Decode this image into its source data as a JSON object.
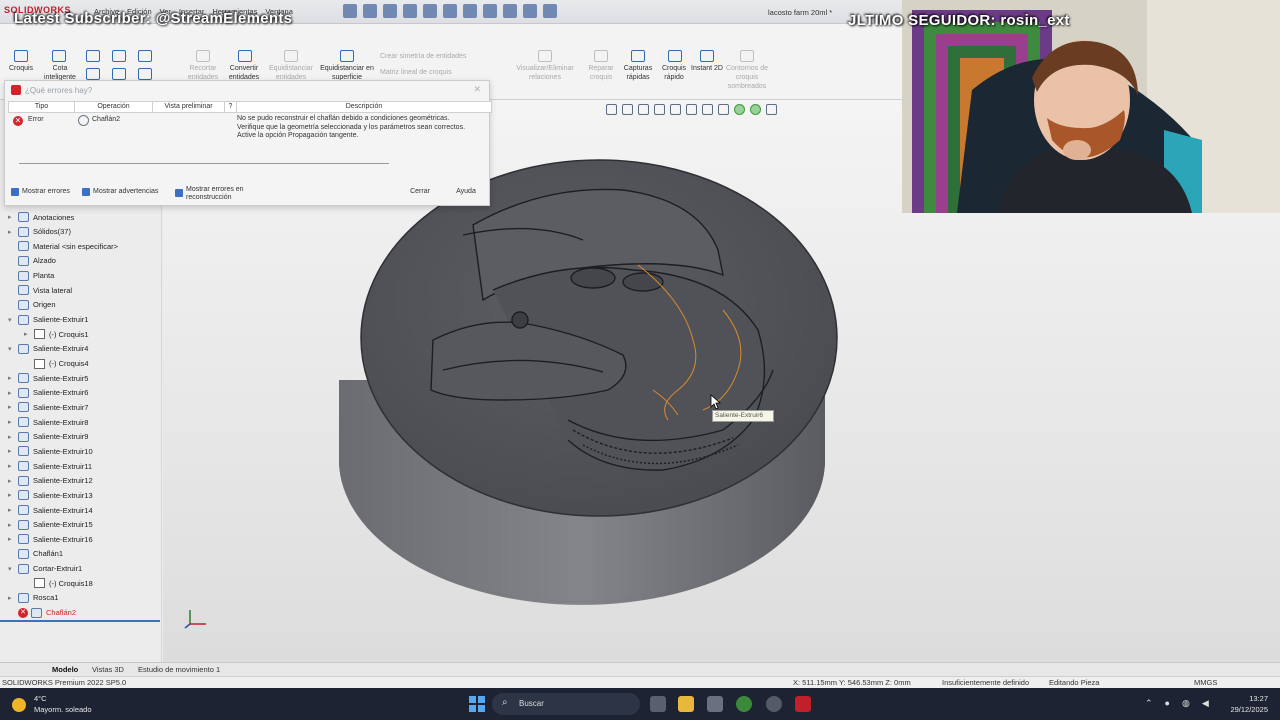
{
  "window": {
    "app_name": "SOLIDWORKS",
    "document_title": "lacosto farm 20ml *",
    "menu": [
      "Archivo",
      "Edición",
      "Ver",
      "Insertar",
      "Herramientas",
      "Ventana"
    ]
  },
  "overlays": {
    "latest_subscriber": "Latest Subscriber: @StreamElements",
    "last_follower": "JLTIMO SEGUIDOR: rosin_ext"
  },
  "ribbon": {
    "buttons": [
      {
        "label": "Croquis",
        "enabled": true
      },
      {
        "label": "Cota inteligente",
        "enabled": true
      },
      {
        "label": "Recortar entidades",
        "enabled": false
      },
      {
        "label": "Convertir entidades",
        "enabled": true
      },
      {
        "label": "Equidistanciar entidades",
        "enabled": false
      },
      {
        "label": "Equidistanciar en superficie",
        "enabled": true
      },
      {
        "label": "Crear simetría de entidades",
        "enabled": false
      },
      {
        "label": "Matriz lineal de croquis",
        "enabled": false
      },
      {
        "label": "Visualizar/Eliminar relaciones",
        "enabled": false
      },
      {
        "label": "Reparar croquis",
        "enabled": false
      },
      {
        "label": "Capturas rápidas",
        "enabled": true
      },
      {
        "label": "Croquis rápido",
        "enabled": true
      },
      {
        "label": "Instant 2D",
        "enabled": true
      },
      {
        "label": "Contornos de croquis sombreados",
        "enabled": false
      }
    ]
  },
  "error_dialog": {
    "title": "¿Qué errores hay?",
    "columns": [
      "Tipo",
      "Operación",
      "Vista preliminar",
      "?",
      "Descripción"
    ],
    "row": {
      "type": "Error",
      "operation": "Chaflán2",
      "description_lines": [
        "No se pudo reconstruir el chaflán debido a condiciones geométricas.",
        "Verifique que la geometría seleccionada y los parámetros sean correctos.",
        "Active la opción Propagación tangente."
      ]
    },
    "checkboxes": [
      {
        "label": "Mostrar errores",
        "checked": true
      },
      {
        "label": "Mostrar advertencias",
        "checked": true
      },
      {
        "label": "Mostrar errores en reconstrucción",
        "checked": true
      }
    ],
    "close_label": "Cerrar",
    "help_label": "Ayuda"
  },
  "feature_tree": [
    {
      "label": "Anotaciones",
      "expander": "▸",
      "level": 0,
      "icon": "annotations-icon"
    },
    {
      "label": "Sólidos(37)",
      "expander": "▸",
      "level": 0,
      "icon": "solid-bodies-icon"
    },
    {
      "label": "Material <sin especificar>",
      "expander": "",
      "level": 0,
      "icon": "material-icon"
    },
    {
      "label": "Alzado",
      "expander": "",
      "level": 0,
      "icon": "plane-icon"
    },
    {
      "label": "Planta",
      "expander": "",
      "level": 0,
      "icon": "plane-icon"
    },
    {
      "label": "Vista lateral",
      "expander": "",
      "level": 0,
      "icon": "plane-icon"
    },
    {
      "label": "Origen",
      "expander": "",
      "level": 0,
      "icon": "origin-icon"
    },
    {
      "label": "Saliente-Extruir1",
      "expander": "▾",
      "level": 0,
      "icon": "extrude-icon"
    },
    {
      "label": "(-) Croquis1",
      "expander": "▸",
      "level": 1,
      "icon": "sketch-icon"
    },
    {
      "label": "Saliente-Extruir4",
      "expander": "▾",
      "level": 0,
      "icon": "extrude-icon"
    },
    {
      "label": "(-) Croquis4",
      "expander": "",
      "level": 1,
      "icon": "sketch-icon"
    },
    {
      "label": "Saliente-Extruir5",
      "expander": "▸",
      "level": 0,
      "icon": "extrude-icon"
    },
    {
      "label": "Saliente-Extruir6",
      "expander": "▸",
      "level": 0,
      "icon": "extrude-icon"
    },
    {
      "label": "Saliente-Extruir7",
      "expander": "▸",
      "level": 0,
      "icon": "extrude-icon"
    },
    {
      "label": "Saliente-Extruir8",
      "expander": "▸",
      "level": 0,
      "icon": "extrude-icon"
    },
    {
      "label": "Saliente-Extruir9",
      "expander": "▸",
      "level": 0,
      "icon": "extrude-icon"
    },
    {
      "label": "Saliente-Extruir10",
      "expander": "▸",
      "level": 0,
      "icon": "extrude-icon"
    },
    {
      "label": "Saliente-Extruir11",
      "expander": "▸",
      "level": 0,
      "icon": "extrude-icon"
    },
    {
      "label": "Saliente-Extruir12",
      "expander": "▸",
      "level": 0,
      "icon": "extrude-icon"
    },
    {
      "label": "Saliente-Extruir13",
      "expander": "▸",
      "level": 0,
      "icon": "extrude-icon"
    },
    {
      "label": "Saliente-Extruir14",
      "expander": "▸",
      "level": 0,
      "icon": "extrude-icon"
    },
    {
      "label": "Saliente-Extruir15",
      "expander": "▸",
      "level": 0,
      "icon": "extrude-icon"
    },
    {
      "label": "Saliente-Extruir16",
      "expander": "▸",
      "level": 0,
      "icon": "extrude-icon"
    },
    {
      "label": "Chaflán1",
      "expander": "",
      "level": 0,
      "icon": "chamfer-icon"
    },
    {
      "label": "Cortar-Extruir1",
      "expander": "▾",
      "level": 0,
      "icon": "cut-extrude-icon"
    },
    {
      "label": "(-) Croquis18",
      "expander": "",
      "level": 1,
      "icon": "sketch-icon"
    },
    {
      "label": "Rosca1",
      "expander": "▸",
      "level": 0,
      "icon": "thread-icon"
    },
    {
      "label": "Chaflán2",
      "expander": "",
      "level": 0,
      "icon": "chamfer-icon",
      "error": true
    }
  ],
  "viewport": {
    "hover_tooltip": "Saliente-Extruir6"
  },
  "bottom_tabs": [
    "Modelo",
    "Vistas 3D",
    "Estudio de movimiento 1"
  ],
  "status_bar": {
    "product": "SOLIDWORKS Premium 2022 SP5.0",
    "coordinates": "X: 511.15mm Y: 546.53mm Z: 0mm",
    "definition": "Insuficientemente definido",
    "mode": "Editando Pieza",
    "units": "MMGS"
  },
  "taskbar": {
    "temperature": "4°C",
    "weather": "Mayorm. soleado",
    "search_placeholder": "Buscar",
    "time": "13:27",
    "date": "29/12/2025"
  },
  "colors": {
    "error_red": "#d6232a",
    "accent_blue": "#3b70c4",
    "taskbar_bg": "#1d2333",
    "model_gray": "#55575c",
    "sketch_orange": "#d98a2e"
  }
}
